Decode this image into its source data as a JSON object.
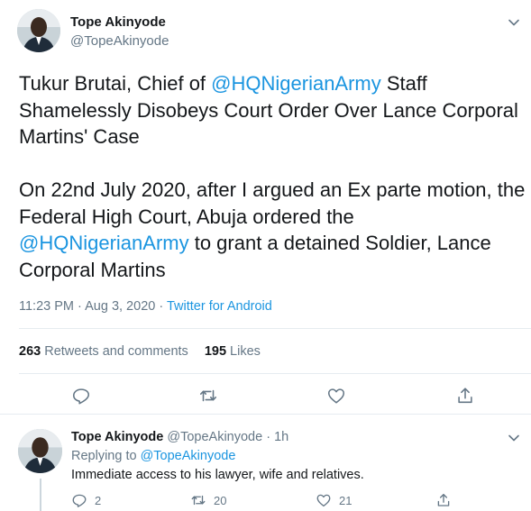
{
  "tweet": {
    "author_name": "Tope Akinyode",
    "author_handle": "@TopeAkinyode",
    "text_p1_a": "Tukur Brutai, Chief of ",
    "text_p1_mention": "@HQNigerianArmy",
    "text_p1_b": " Staff Shamelessly Disobeys Court Order Over Lance Corporal Martins' Case",
    "text_p2_a": "On 22nd July 2020, after I argued an Ex parte motion, the Federal High Court, Abuja ordered the ",
    "text_p2_mention": "@HQNigerianArmy",
    "text_p2_b": " to grant a detained Soldier, Lance Corporal Martins",
    "time": "11:23 PM",
    "date": "Aug 3, 2020",
    "sep": "·",
    "source": "Twitter for Android",
    "retweets_count": "263",
    "retweets_label": "Retweets and comments",
    "likes_count": "195",
    "likes_label": "Likes"
  },
  "reply": {
    "author_name": "Tope Akinyode",
    "author_handle": "@TopeAkinyode",
    "age": "1h",
    "replying_prefix": "Replying to",
    "replying_handle": "@TopeAkinyode",
    "text": "Immediate access to his lawyer, wife and relatives.",
    "reply_count": "2",
    "retweet_count": "20",
    "like_count": "21"
  },
  "colors": {
    "link": "#1b95e0",
    "muted": "#657786",
    "text": "#14171a",
    "divider": "#e6ecf0"
  },
  "icons": [
    "chevron-down-icon",
    "reply-icon",
    "retweet-icon",
    "like-icon",
    "share-icon"
  ]
}
